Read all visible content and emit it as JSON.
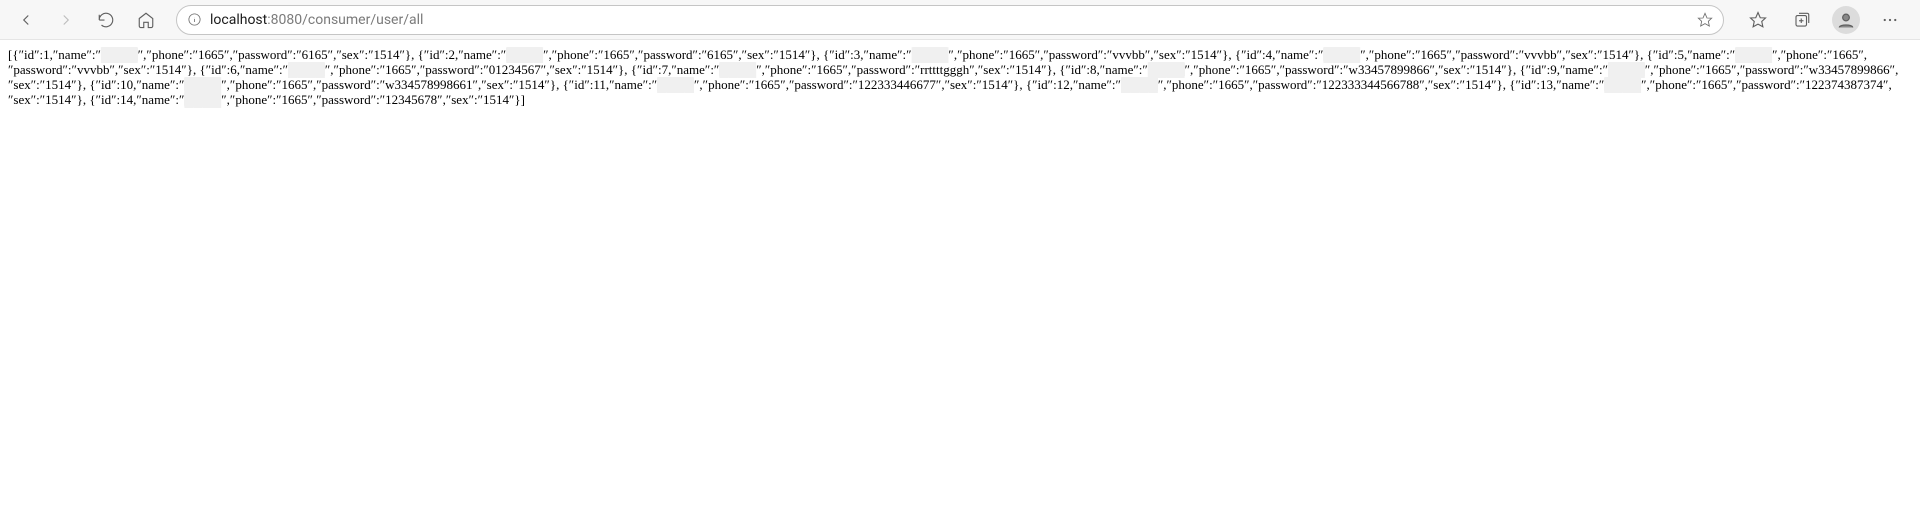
{
  "toolbar": {
    "url": {
      "host": "localhost",
      "port": ":8080",
      "path": "/consumer/user/all"
    }
  },
  "response": {
    "records": [
      {
        "id": 1,
        "name": "████",
        "phone": "1665",
        "password": "6165",
        "sex": "1514"
      },
      {
        "id": 2,
        "name": "████",
        "phone": "1665",
        "password": "6165",
        "sex": "1514"
      },
      {
        "id": 3,
        "name": "████",
        "phone": "1665",
        "password": "vvvbb",
        "sex": "1514"
      },
      {
        "id": 4,
        "name": "████",
        "phone": "1665",
        "password": "vvvbb",
        "sex": "1514"
      },
      {
        "id": 5,
        "name": "████",
        "phone": "1665",
        "password": "vvvbb",
        "sex": "1514"
      },
      {
        "id": 6,
        "name": "████",
        "phone": "1665",
        "password": "01234567",
        "sex": "1514"
      },
      {
        "id": 7,
        "name": "████",
        "phone": "1665",
        "password": "rrttttgggh",
        "sex": "1514"
      },
      {
        "id": 8,
        "name": "████",
        "phone": "1665",
        "password": "w33457899866",
        "sex": "1514"
      },
      {
        "id": 9,
        "name": "████",
        "phone": "1665",
        "password": "w33457899866",
        "sex": "1514"
      },
      {
        "id": 10,
        "name": "████",
        "phone": "1665",
        "password": "w334578998661",
        "sex": "1514"
      },
      {
        "id": 11,
        "name": "████",
        "phone": "1665",
        "password": "122333446677",
        "sex": "1514"
      },
      {
        "id": 12,
        "name": "████",
        "phone": "1665",
        "password": "122333344566788",
        "sex": "1514"
      },
      {
        "id": 13,
        "name": "████",
        "phone": "1665",
        "password": "122374387374",
        "sex": "1514"
      },
      {
        "id": 14,
        "name": "████",
        "phone": "1665",
        "password": "12345678",
        "sex": "1514"
      }
    ]
  }
}
